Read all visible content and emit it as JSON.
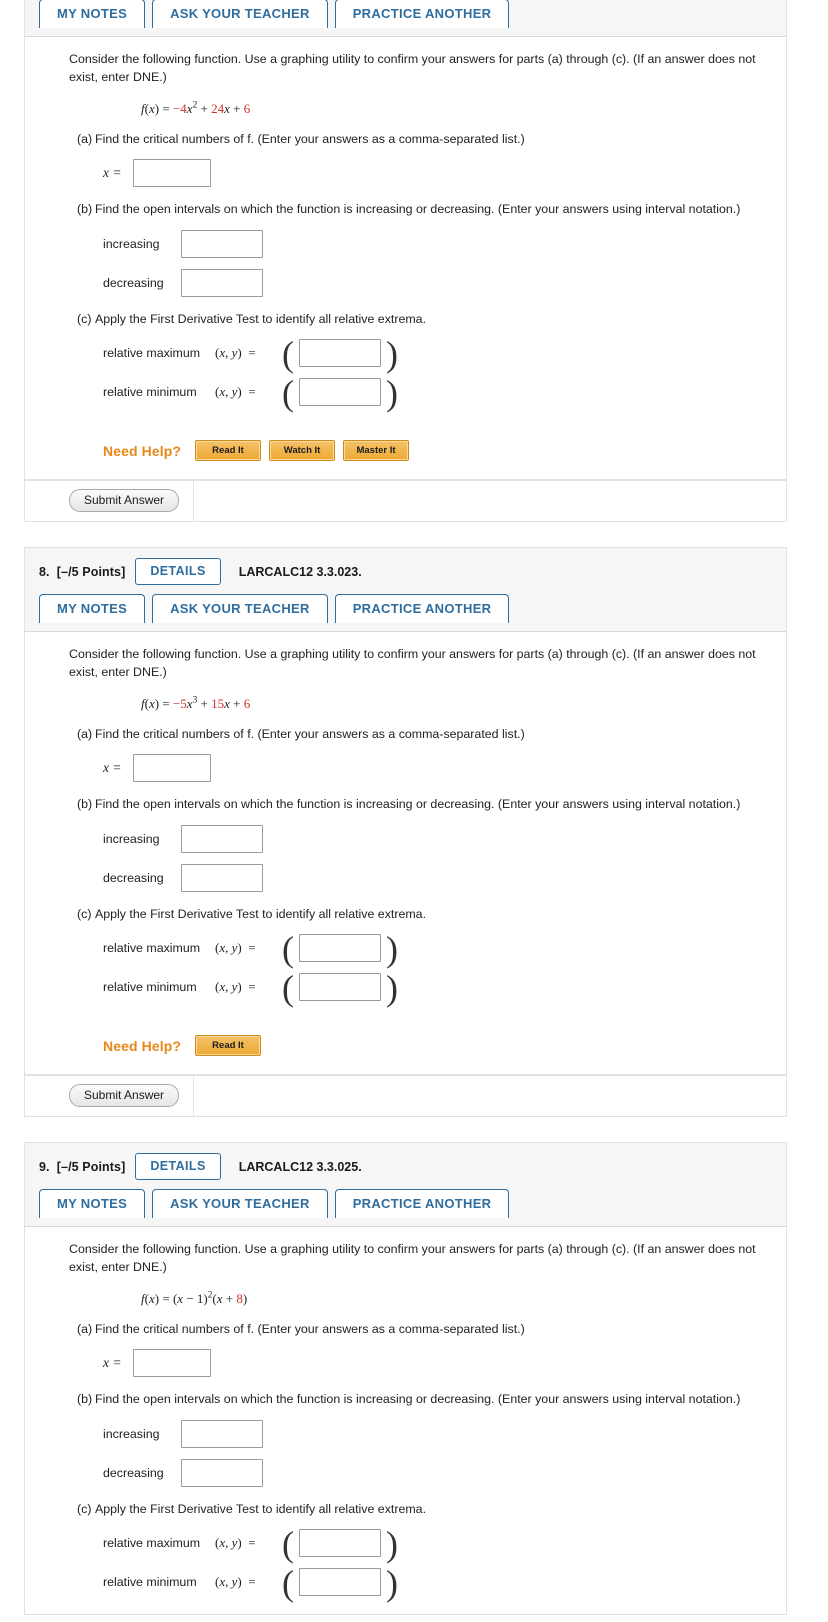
{
  "questions": [
    {
      "id": "q7",
      "number": "",
      "points": "",
      "details_label": "DETAILS",
      "code": "",
      "show_header": false,
      "tabs": [
        {
          "label": "MY NOTES"
        },
        {
          "label": "ASK YOUR TEACHER"
        },
        {
          "label": "PRACTICE ANOTHER"
        }
      ],
      "prompt": "Consider the following function. Use a graphing utility to confirm your answers for parts (a) through (c). (If an answer does not exist, enter DNE.)",
      "formula": {
        "lhs": "f(x)",
        "eq": "=",
        "terms": [
          {
            "text": "−4",
            "color": "red"
          },
          {
            "text": "x",
            "color": "black",
            "italic": true
          },
          {
            "text": "2",
            "color": "black",
            "sup": true
          },
          {
            "text": " + ",
            "color": "black"
          },
          {
            "text": "24",
            "color": "red"
          },
          {
            "text": "x",
            "color": "black",
            "italic": true
          },
          {
            "text": " + ",
            "color": "black"
          },
          {
            "text": "6",
            "color": "red"
          }
        ]
      },
      "parts": [
        {
          "label": "(a)",
          "text": "Find the critical numbers of f. (Enter your answers as a comma-separated list.)",
          "rows": [
            {
              "type": "x",
              "label": "x ="
            }
          ]
        },
        {
          "label": "(b)",
          "text": "Find the open intervals on which the function is increasing or decreasing. (Enter your answers using interval notation.)",
          "rows": [
            {
              "type": "plain",
              "label": "increasing"
            },
            {
              "type": "plain",
              "label": "decreasing"
            }
          ]
        },
        {
          "label": "(c)",
          "text": "Apply the First Derivative Test to identify all relative extrema.",
          "rows": [
            {
              "type": "xy",
              "label": "relative maximum",
              "xy": "(x, y)  ="
            },
            {
              "type": "xy",
              "label": "relative minimum",
              "xy": "(x, y)  ="
            }
          ]
        }
      ],
      "need_help": {
        "label": "Need Help?",
        "buttons": [
          {
            "label": "Read It"
          },
          {
            "label": "Watch It"
          },
          {
            "label": "Master It"
          }
        ]
      },
      "submit_label": "Submit Answer"
    },
    {
      "id": "q8",
      "number": "8.",
      "points": "[–/5 Points]",
      "details_label": "DETAILS",
      "code": "LARCALC12 3.3.023.",
      "show_header": true,
      "tabs": [
        {
          "label": "MY NOTES"
        },
        {
          "label": "ASK YOUR TEACHER"
        },
        {
          "label": "PRACTICE ANOTHER"
        }
      ],
      "prompt": "Consider the following function. Use a graphing utility to confirm your answers for parts (a) through (c). (If an answer does not exist, enter DNE.)",
      "formula": {
        "lhs": "f(x)",
        "eq": "=",
        "terms": [
          {
            "text": "−5",
            "color": "red"
          },
          {
            "text": "x",
            "color": "black",
            "italic": true
          },
          {
            "text": "3",
            "color": "black",
            "sup": true
          },
          {
            "text": " + ",
            "color": "black"
          },
          {
            "text": "15",
            "color": "red"
          },
          {
            "text": "x",
            "color": "black",
            "italic": true
          },
          {
            "text": " + ",
            "color": "black"
          },
          {
            "text": "6",
            "color": "red"
          }
        ]
      },
      "parts": [
        {
          "label": "(a)",
          "text": "Find the critical numbers of f. (Enter your answers as a comma-separated list.)",
          "rows": [
            {
              "type": "x",
              "label": "x ="
            }
          ]
        },
        {
          "label": "(b)",
          "text": "Find the open intervals on which the function is increasing or decreasing. (Enter your answers using interval notation.)",
          "rows": [
            {
              "type": "plain",
              "label": "increasing"
            },
            {
              "type": "plain",
              "label": "decreasing"
            }
          ]
        },
        {
          "label": "(c)",
          "text": "Apply the First Derivative Test to identify all relative extrema.",
          "rows": [
            {
              "type": "xy",
              "label": "relative maximum",
              "xy": "(x, y)  ="
            },
            {
              "type": "xy",
              "label": "relative minimum",
              "xy": "(x, y)  ="
            }
          ]
        }
      ],
      "need_help": {
        "label": "Need Help?",
        "buttons": [
          {
            "label": "Read It"
          }
        ]
      },
      "submit_label": "Submit Answer"
    },
    {
      "id": "q9",
      "number": "9.",
      "points": "[–/5 Points]",
      "details_label": "DETAILS",
      "code": "LARCALC12 3.3.025.",
      "show_header": true,
      "tabs": [
        {
          "label": "MY NOTES"
        },
        {
          "label": "ASK YOUR TEACHER"
        },
        {
          "label": "PRACTICE ANOTHER"
        }
      ],
      "prompt": "Consider the following function. Use a graphing utility to confirm your answers for parts (a) through (c). (If an answer does not exist, enter DNE.)",
      "formula": {
        "lhs": "f(x)",
        "eq": "=",
        "terms": [
          {
            "text": "(",
            "color": "black"
          },
          {
            "text": "x",
            "color": "black",
            "italic": true
          },
          {
            "text": " − 1)",
            "color": "black"
          },
          {
            "text": "2",
            "color": "black",
            "sup": true
          },
          {
            "text": "(",
            "color": "black"
          },
          {
            "text": "x",
            "color": "black",
            "italic": true
          },
          {
            "text": " + ",
            "color": "black"
          },
          {
            "text": "8",
            "color": "red"
          },
          {
            "text": ")",
            "color": "black"
          }
        ]
      },
      "parts": [
        {
          "label": "(a)",
          "text": "Find the critical numbers of f. (Enter your answers as a comma-separated list.)",
          "rows": [
            {
              "type": "x",
              "label": "x ="
            }
          ]
        },
        {
          "label": "(b)",
          "text": "Find the open intervals on which the function is increasing or decreasing. (Enter your answers using interval notation.)",
          "rows": [
            {
              "type": "plain",
              "label": "increasing"
            },
            {
              "type": "plain",
              "label": "decreasing"
            }
          ]
        },
        {
          "label": "(c)",
          "text": "Apply the First Derivative Test to identify all relative extrema.",
          "rows": [
            {
              "type": "xy",
              "label": "relative maximum",
              "xy": "(x, y)  ="
            },
            {
              "type": "xy",
              "label": "relative minimum",
              "xy": "(x, y)  ="
            }
          ]
        }
      ],
      "need_help": null,
      "submit_label": null
    }
  ],
  "colors": {
    "link_blue": "#2f6d9e",
    "accent_orange": "#e8871a",
    "math_red": "#d0312d",
    "panel_grey": "#f6f6f6"
  }
}
